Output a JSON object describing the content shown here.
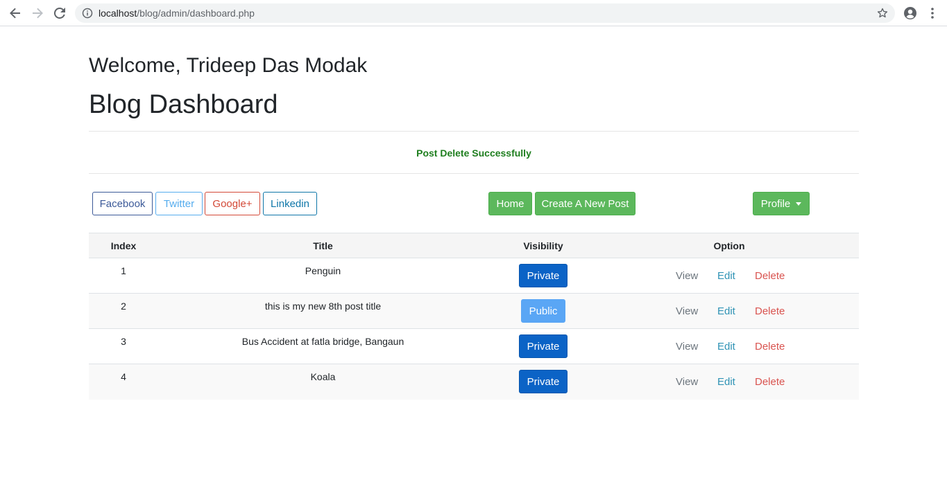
{
  "browser": {
    "url_host": "localhost",
    "url_path": "/blog/admin/dashboard.php"
  },
  "page": {
    "welcome": "Welcome, Trideep Das Modak",
    "title": "Blog Dashboard",
    "alert": "Post Delete Successfully"
  },
  "social": {
    "facebook": "Facebook",
    "twitter": "Twitter",
    "google": "Google+",
    "linkedin": "Linkedin"
  },
  "actions": {
    "home": "Home",
    "create": "Create A New Post",
    "profile": "Profile"
  },
  "table": {
    "headers": {
      "index": "Index",
      "title": "Title",
      "visibility": "Visibility",
      "option": "Option"
    },
    "rows": [
      {
        "index": "1",
        "title": "Penguin",
        "visibility": "Private",
        "view": "View",
        "edit": "Edit",
        "delete": "Delete"
      },
      {
        "index": "2",
        "title": "this is my new 8th post title",
        "visibility": "Public",
        "view": "View",
        "edit": "Edit",
        "delete": "Delete"
      },
      {
        "index": "3",
        "title": "Bus Accident at fatla bridge, Bangaun",
        "visibility": "Private",
        "view": "View",
        "edit": "Edit",
        "delete": "Delete"
      },
      {
        "index": "4",
        "title": "Koala",
        "visibility": "Private",
        "view": "View",
        "edit": "Edit",
        "delete": "Delete"
      }
    ]
  },
  "colors": {
    "success": "#5cb85c",
    "private": "#0b63c6",
    "public": "#5aa6f5",
    "alert_text": "#1e7e1e"
  }
}
